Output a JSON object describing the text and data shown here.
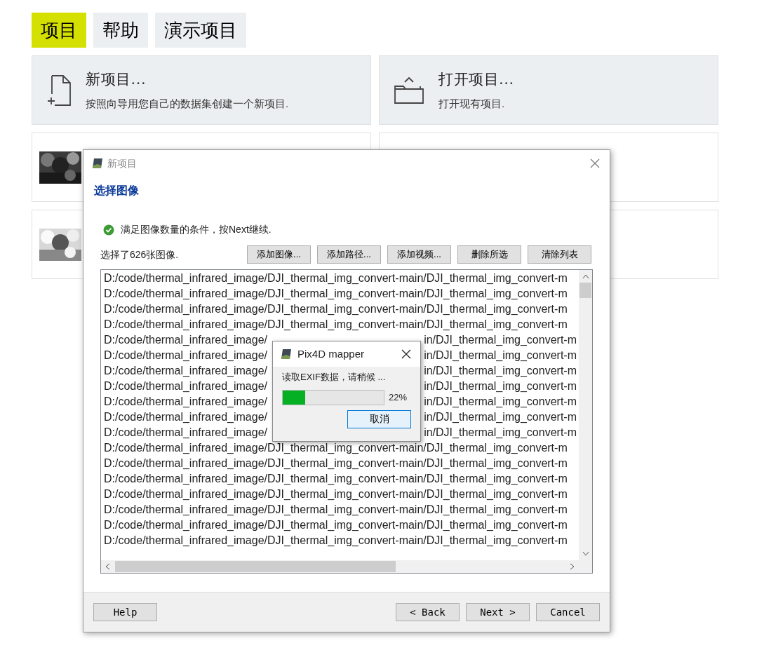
{
  "tabs": [
    {
      "label": "项目",
      "selected": true
    },
    {
      "label": "帮助",
      "selected": false
    },
    {
      "label": "演示项目",
      "selected": false
    }
  ],
  "actions": [
    {
      "kind": "new",
      "title": "新项目...",
      "description": "按照向导用您自己的数据集创建一个新项目."
    },
    {
      "kind": "open",
      "title": "打开项目...",
      "description": "打开现有项目."
    }
  ],
  "dialog": {
    "title": "新项目",
    "heading": "选择图像",
    "status": "满足图像数量的条件，按Next继续.",
    "count": "选择了626张图像.",
    "list_buttons": [
      "添加图像...",
      "添加路径...",
      "添加视频...",
      "删除所选",
      "清除列表"
    ],
    "rows": [
      {
        "kind": "full",
        "text": "D:/code/thermal_infrared_image/DJI_thermal_img_convert-main/DJI_thermal_img_convert-m"
      },
      {
        "kind": "full",
        "text": "D:/code/thermal_infrared_image/DJI_thermal_img_convert-main/DJI_thermal_img_convert-m"
      },
      {
        "kind": "full",
        "text": "D:/code/thermal_infrared_image/DJI_thermal_img_convert-main/DJI_thermal_img_convert-m"
      },
      {
        "kind": "full",
        "text": "D:/code/thermal_infrared_image/DJI_thermal_img_convert-main/DJI_thermal_img_convert-m"
      },
      {
        "kind": "split",
        "left": "D:/code/thermal_infrared_image/",
        "right": "in/DJI_thermal_img_convert-m"
      },
      {
        "kind": "split",
        "left": "D:/code/thermal_infrared_image/",
        "right": "in/DJI_thermal_img_convert-m"
      },
      {
        "kind": "split",
        "left": "D:/code/thermal_infrared_image/",
        "right": "in/DJI_thermal_img_convert-m"
      },
      {
        "kind": "split",
        "left": "D:/code/thermal_infrared_image/",
        "right": "in/DJI_thermal_img_convert-m"
      },
      {
        "kind": "split",
        "left": "D:/code/thermal_infrared_image/",
        "right": "in/DJI_thermal_img_convert-m"
      },
      {
        "kind": "split",
        "left": "D:/code/thermal_infrared_image/",
        "right": "in/DJI_thermal_img_convert-m"
      },
      {
        "kind": "split",
        "left": "D:/code/thermal_infrared_image/",
        "right": "in/DJI_thermal_img_convert-m"
      },
      {
        "kind": "full",
        "text": "D:/code/thermal_infrared_image/DJI_thermal_img_convert-main/DJI_thermal_img_convert-m"
      },
      {
        "kind": "full",
        "text": "D:/code/thermal_infrared_image/DJI_thermal_img_convert-main/DJI_thermal_img_convert-m"
      },
      {
        "kind": "full",
        "text": "D:/code/thermal_infrared_image/DJI_thermal_img_convert-main/DJI_thermal_img_convert-m"
      },
      {
        "kind": "full",
        "text": "D:/code/thermal_infrared_image/DJI_thermal_img_convert-main/DJI_thermal_img_convert-m"
      },
      {
        "kind": "full",
        "text": "D:/code/thermal_infrared_image/DJI_thermal_img_convert-main/DJI_thermal_img_convert-m"
      },
      {
        "kind": "full",
        "text": "D:/code/thermal_infrared_image/DJI_thermal_img_convert-main/DJI_thermal_img_convert-m"
      },
      {
        "kind": "full",
        "text": "D:/code/thermal_infrared_image/DJI_thermal_img_convert-main/DJI_thermal_img_convert-m"
      }
    ],
    "footer_buttons": [
      {
        "kind": "help",
        "label": "Help"
      },
      {
        "kind": "back",
        "label": "< Back"
      },
      {
        "kind": "next",
        "label": "Next >"
      },
      {
        "kind": "cancel",
        "label": "Cancel"
      }
    ]
  },
  "progress": {
    "title": "Pix4D mapper",
    "message": "读取EXIF数据，请稍候 ...",
    "level": 0.22,
    "reading": "22%",
    "button": "取消"
  }
}
